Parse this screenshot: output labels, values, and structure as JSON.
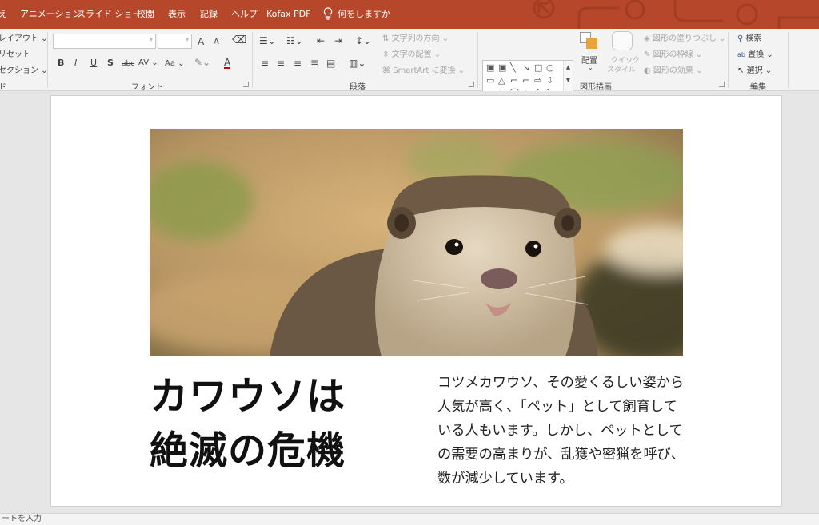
{
  "tabs": [
    "え",
    "アニメーション",
    "スライド ショー",
    "校閲",
    "表示",
    "記録",
    "ヘルプ",
    "Kofax PDF"
  ],
  "tell_me": "何をしますか",
  "ribbon": {
    "slides_group": {
      "layout": "レイアウト",
      "reset": "リセット",
      "section": "セクション",
      "label": "ド"
    },
    "font_group": {
      "label": "フォント",
      "grow": "A",
      "shrink": "A",
      "bold": "B",
      "italic": "I",
      "underline": "U",
      "shadow": "S",
      "strike": "abc",
      "spacing": "AV",
      "case": "Aa",
      "color": "A"
    },
    "paragraph_group": {
      "label": "段落",
      "text_direction": "文字列の方向",
      "align_text": "文字の配置",
      "smartart": "SmartArt に変換"
    },
    "drawing_group": {
      "label": "図形描画",
      "arrange": "配置",
      "quick_style_1": "クイック",
      "quick_style_2": "スタイル",
      "fill": "図形の塗りつぶし",
      "outline": "図形の枠線",
      "effects": "図形の効果"
    },
    "editing_group": {
      "label": "編集",
      "find": "検索",
      "replace": "置換",
      "select": "選択"
    }
  },
  "slide": {
    "headline_line1": "カワウソは",
    "headline_line2": "絶滅の危機",
    "body": "コツメカワウソ、その愛くるしい姿から人気が高く、「ペット」として飼育している人もいます。しかし、ペットとしての需要の高まりが、乱獲や密猟を呼び、数が減少しています。"
  },
  "status": {
    "notes_hint": "ートを入力"
  },
  "colors": {
    "accent": "#b7472a",
    "ribbon": "#f3f3f3",
    "workspace": "#e6e6e6"
  }
}
